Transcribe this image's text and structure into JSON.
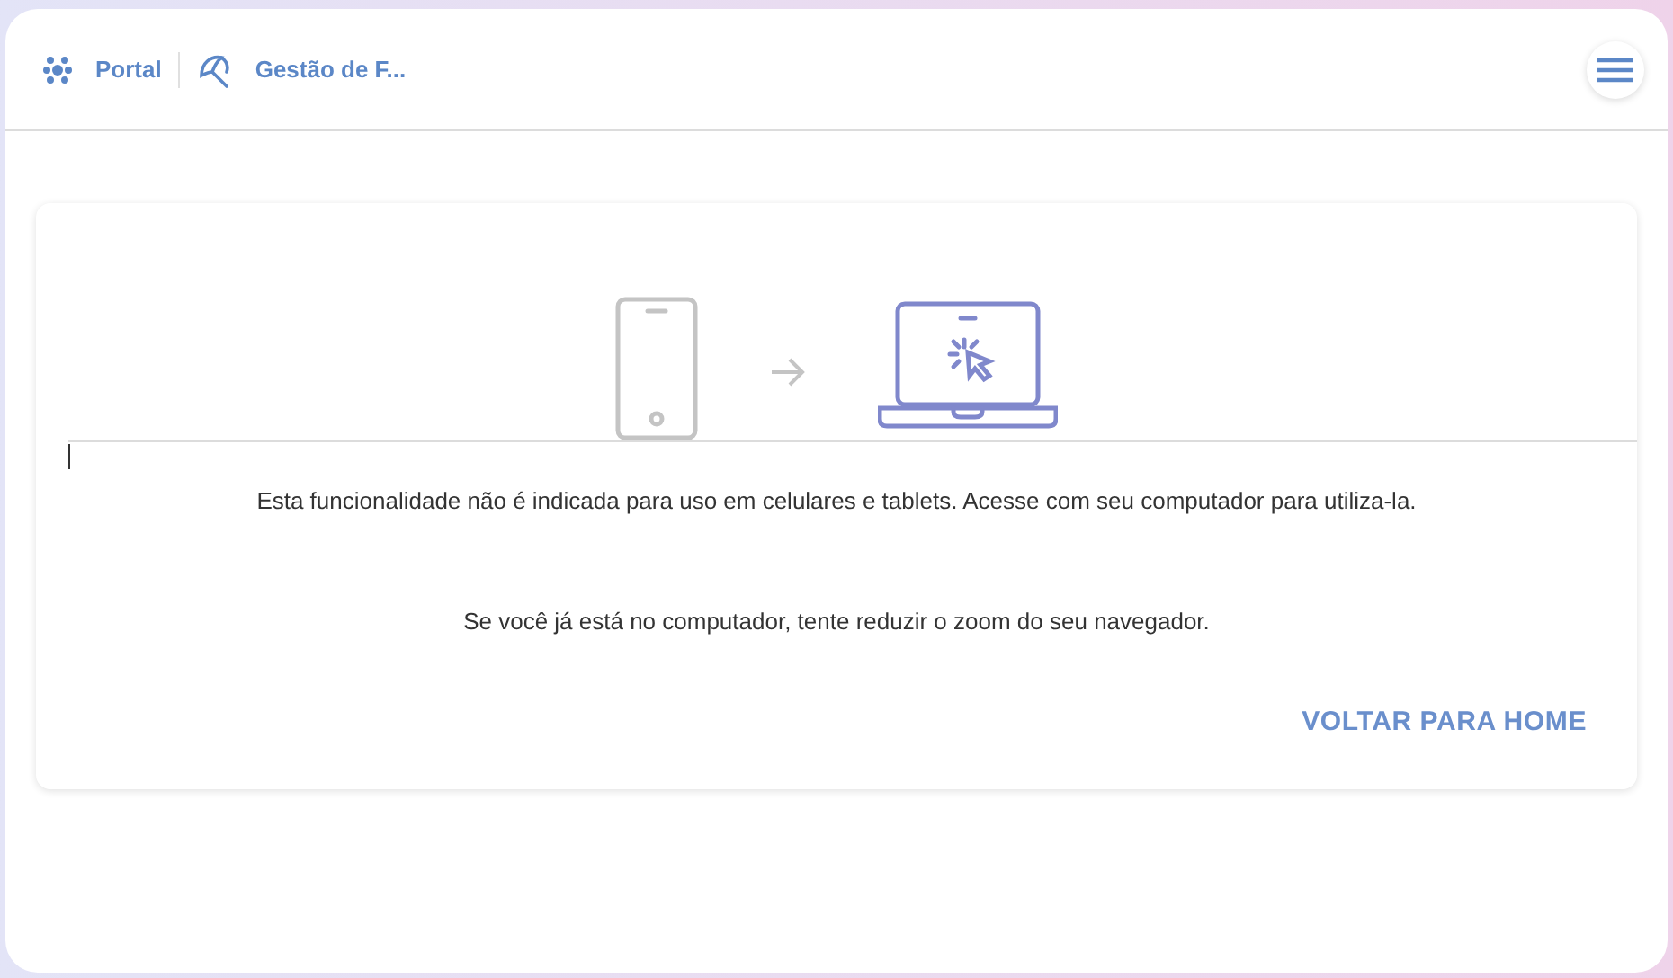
{
  "header": {
    "breadcrumbs": [
      {
        "label": "Portal"
      },
      {
        "label": "Gestão de F..."
      }
    ]
  },
  "notice": {
    "message": "Esta funcionalidade não é indicada para uso em celulares e tablets. Acesse com seu computador para utiliza-la.",
    "hint": "Se você já está no computador, tente reduzir o zoom do seu navegador.",
    "action": "VOLTAR PARA HOME"
  }
}
